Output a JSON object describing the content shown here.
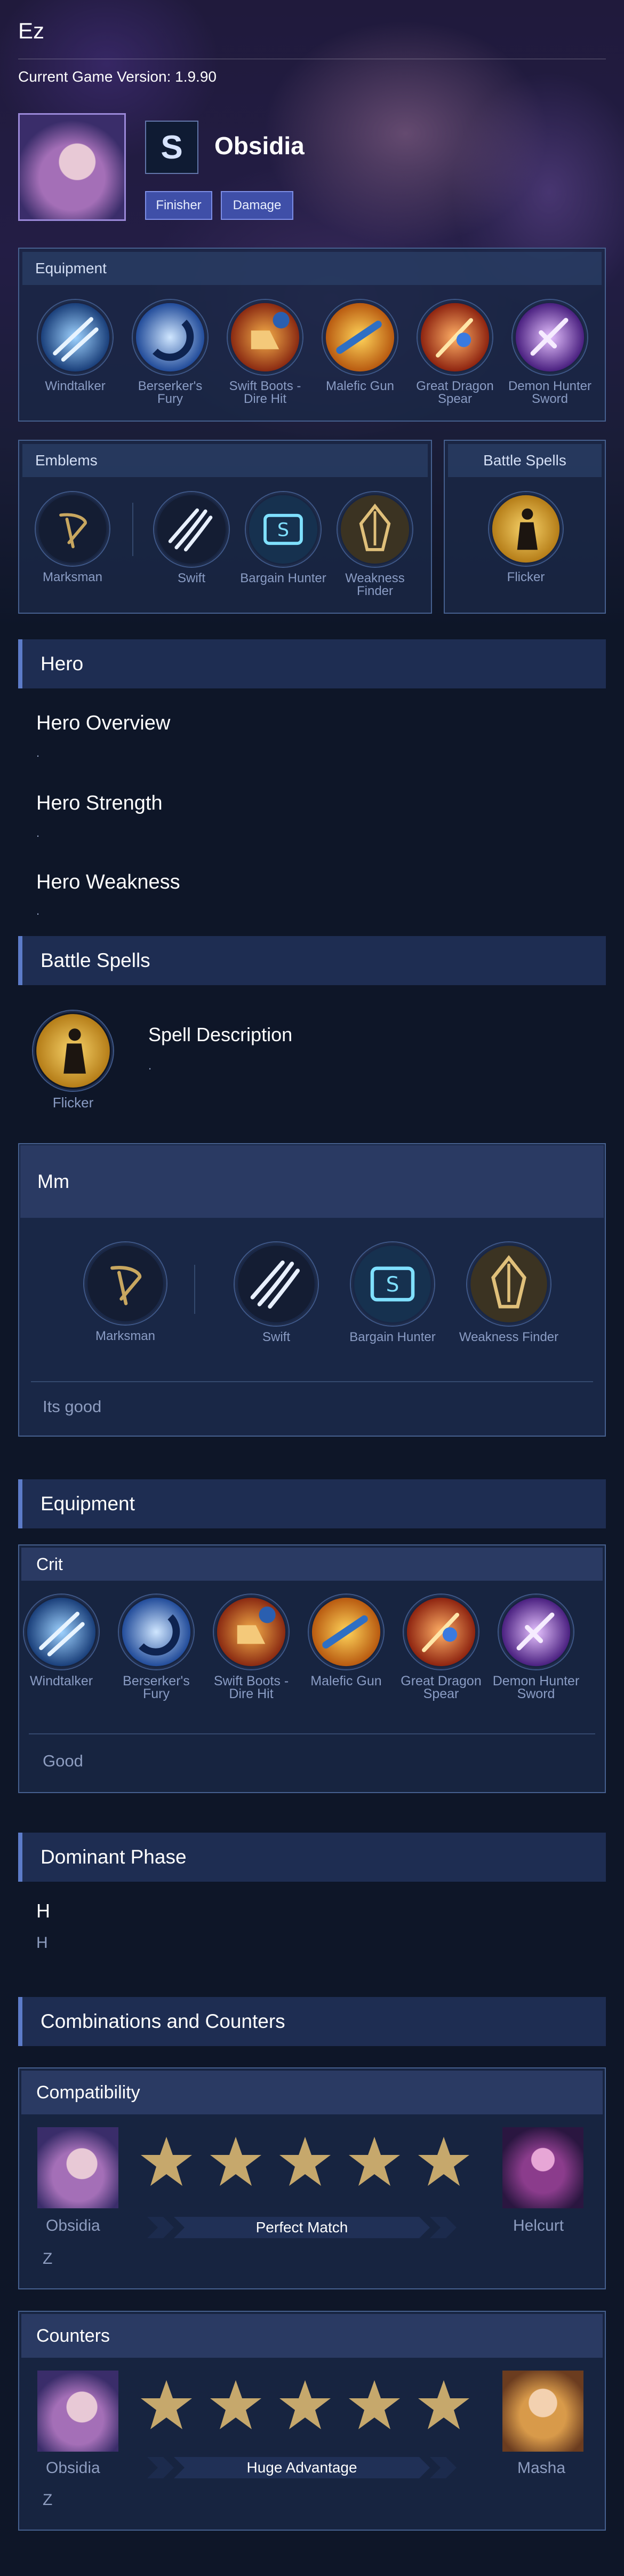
{
  "header": {
    "title": "Ez",
    "version": "Current Game Version: 1.9.90"
  },
  "hero": {
    "name": "Obsidia",
    "role_icon": "S",
    "tags": [
      "Finisher",
      "Damage"
    ]
  },
  "equipment_panel": {
    "title": "Equipment",
    "items": [
      "Windtalker",
      "Berserker's Fury",
      "Swift Boots - Dire Hit",
      "Malefic Gun",
      "Great Dragon Spear",
      "Demon Hunter Sword"
    ]
  },
  "emblems_panel": {
    "title": "Emblems",
    "main": "Marksman",
    "talents": [
      "Swift",
      "Bargain Hunter",
      "Weakness Finder"
    ]
  },
  "spells_panel": {
    "title": "Battle Spells",
    "spell": "Flicker"
  },
  "hero_section": {
    "title": "Hero",
    "overview_title": "Hero Overview",
    "overview_text": ".",
    "strength_title": "Hero Strength",
    "strength_text": ".",
    "weakness_title": "Hero Weakness",
    "weakness_text": "."
  },
  "battle_spells_section": {
    "title": "Battle Spells",
    "spell": "Flicker",
    "desc_title": "Spell Description",
    "desc_text": "."
  },
  "emblem_build": {
    "title": "Mm",
    "main": "Marksman",
    "talents": [
      "Swift",
      "Bargain Hunter",
      "Weakness Finder"
    ],
    "note": "Its good"
  },
  "equipment_section": {
    "title": "Equipment",
    "build_title": "Crit",
    "items": [
      "Windtalker",
      "Berserker's Fury",
      "Swift Boots - Dire Hit",
      "Malefic Gun",
      "Great Dragon Spear",
      "Demon Hunter Sword"
    ],
    "note": "Good"
  },
  "dominant_phase": {
    "title": "Dominant Phase",
    "heading": "H",
    "text": "H"
  },
  "combos": {
    "title": "Combinations and Counters",
    "compatibility": {
      "title": "Compatibility",
      "hero": "Obsidia",
      "partner": "Helcurt",
      "rating": 5,
      "label": "Perfect Match",
      "note": "Z"
    },
    "counters": {
      "title": "Counters",
      "hero": "Obsidia",
      "partner": "Masha",
      "rating": 5,
      "label": "Huge Advantage",
      "note": "Z"
    }
  },
  "colors": {
    "accent": "#5c7bc8",
    "star": "#c6a86c",
    "panel_border": "#46608f",
    "tag": "#3f4fa8"
  },
  "icons": {
    "items": [
      "windtalker-icon",
      "berserkers-fury-icon",
      "swift-boots-icon",
      "malefic-gun-icon",
      "great-dragon-spear-icon",
      "demon-hunter-sword-icon"
    ],
    "emblem": "marksman-emblem-icon",
    "talents": [
      "swift-talent-icon",
      "bargain-hunter-talent-icon",
      "weakness-finder-talent-icon"
    ],
    "spell": "flicker-spell-icon"
  }
}
